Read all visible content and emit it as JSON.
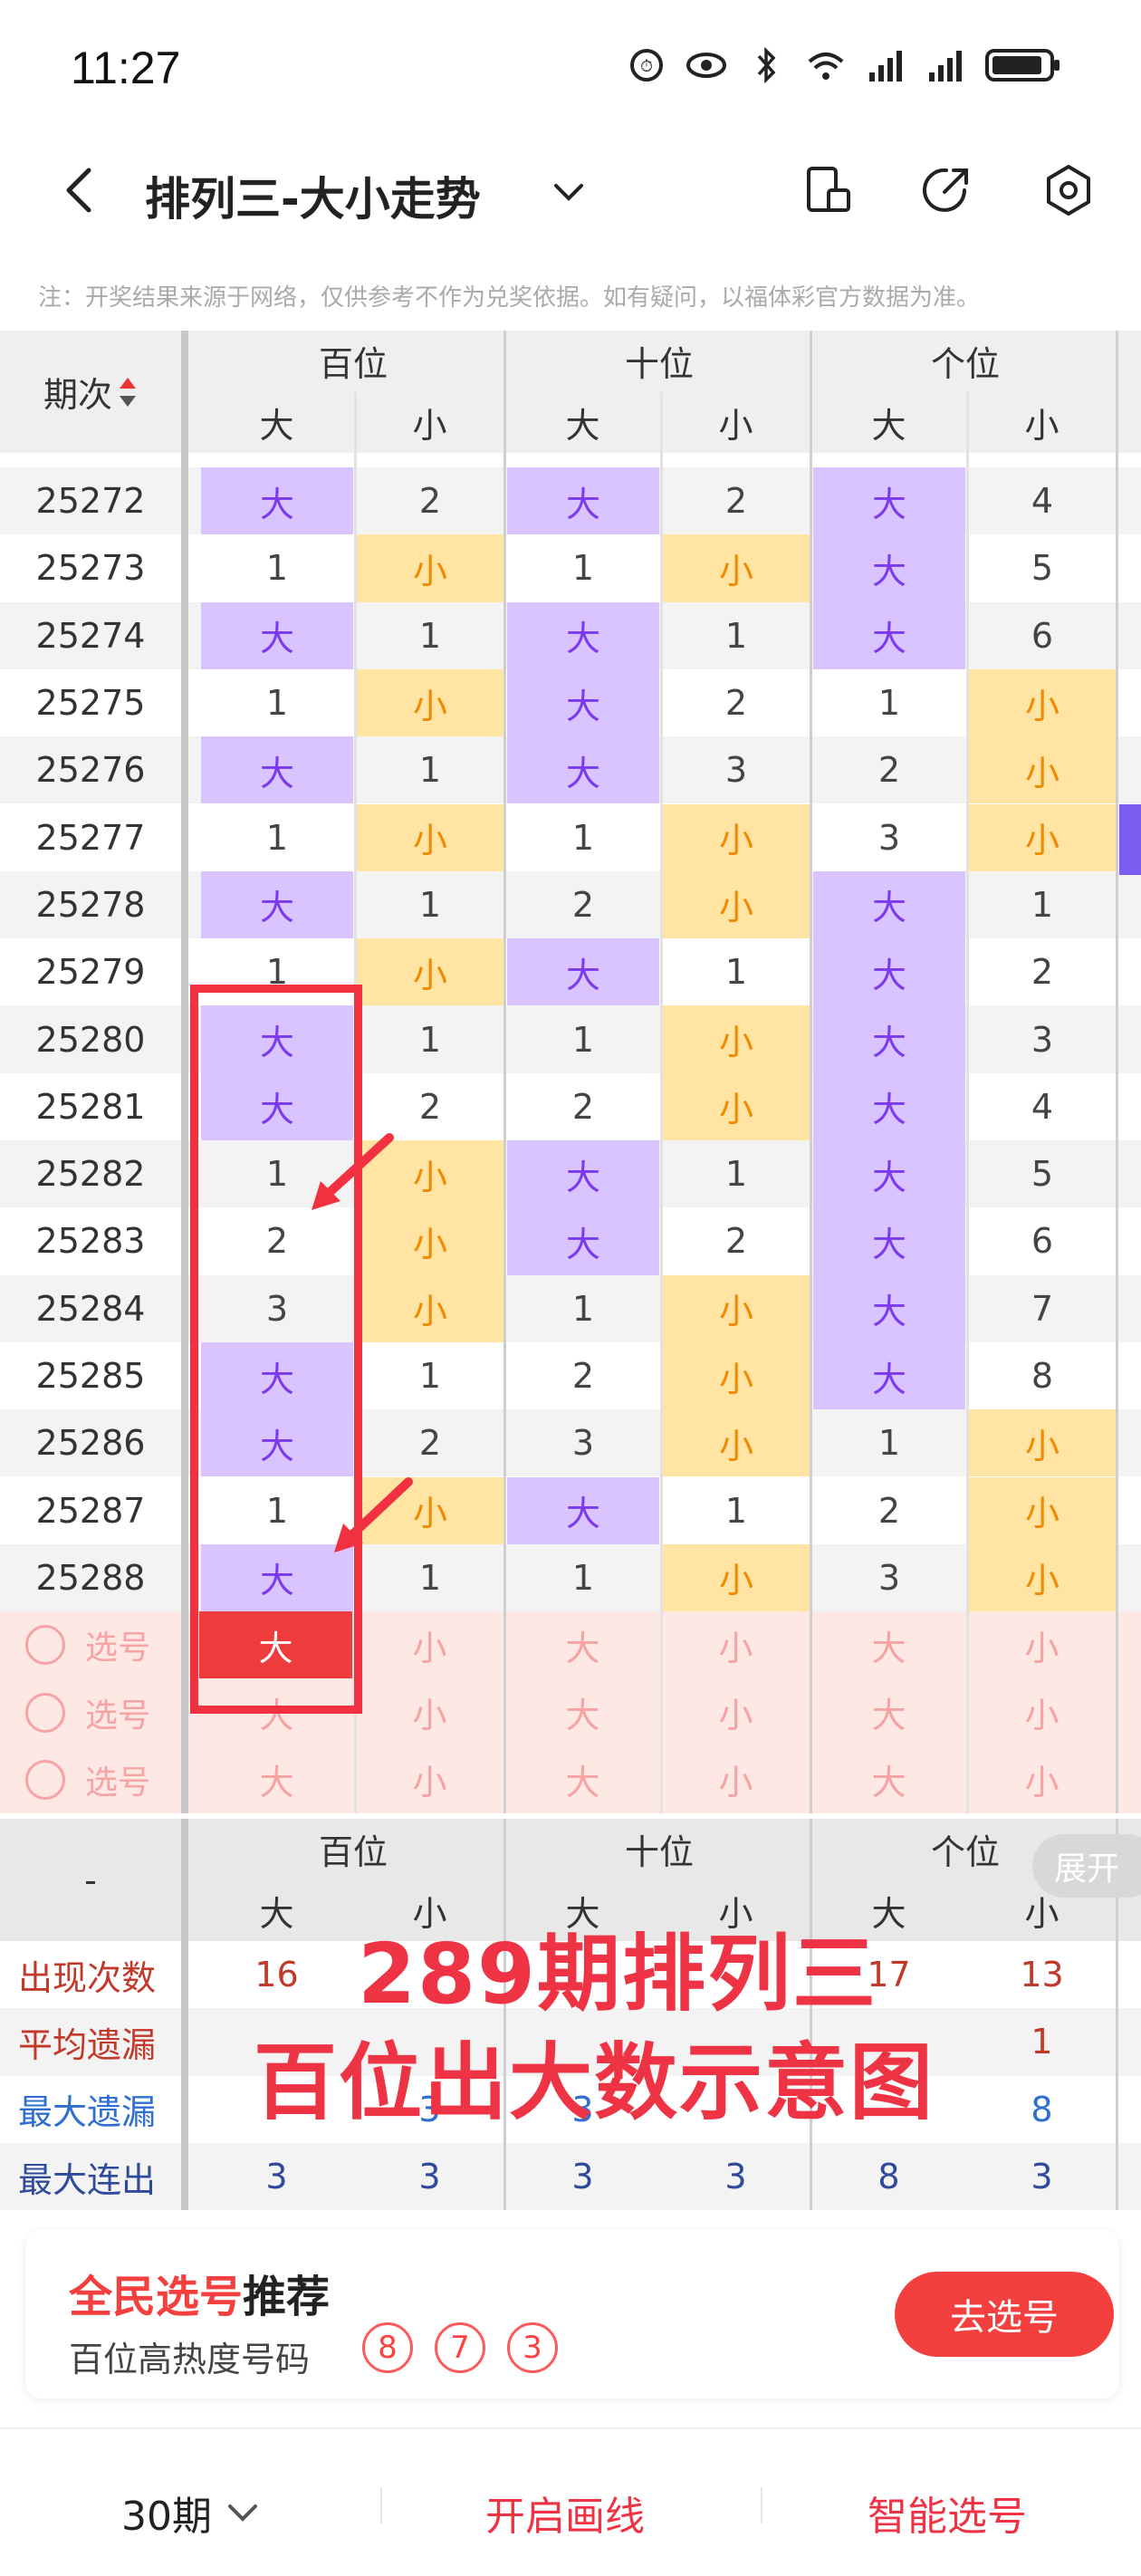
{
  "status": {
    "time": "11:27"
  },
  "header": {
    "title": "排列三-大小走势"
  },
  "notice": "注：开奖结果来源于网络，仅供参考不作为兑奖依据。如有疑问，以福体彩官方数据为准。",
  "table": {
    "period_header": "期次",
    "groups": [
      "百位",
      "十位",
      "个位"
    ],
    "sub_labels": [
      "大",
      "小"
    ],
    "rows": [
      {
        "period": "25272",
        "cells": [
          "大",
          "2",
          "大",
          "2",
          "大",
          "4"
        ]
      },
      {
        "period": "25273",
        "cells": [
          "1",
          "小",
          "1",
          "小",
          "大",
          "5"
        ]
      },
      {
        "period": "25274",
        "cells": [
          "大",
          "1",
          "大",
          "1",
          "大",
          "6"
        ]
      },
      {
        "period": "25275",
        "cells": [
          "1",
          "小",
          "大",
          "2",
          "1",
          "小"
        ]
      },
      {
        "period": "25276",
        "cells": [
          "大",
          "1",
          "大",
          "3",
          "2",
          "小"
        ]
      },
      {
        "period": "25277",
        "cells": [
          "1",
          "小",
          "1",
          "小",
          "3",
          "小"
        ]
      },
      {
        "period": "25278",
        "cells": [
          "大",
          "1",
          "2",
          "小",
          "大",
          "1"
        ]
      },
      {
        "period": "25279",
        "cells": [
          "1",
          "小",
          "大",
          "1",
          "大",
          "2"
        ]
      },
      {
        "period": "25280",
        "cells": [
          "大",
          "1",
          "1",
          "小",
          "大",
          "3"
        ]
      },
      {
        "period": "25281",
        "cells": [
          "大",
          "2",
          "2",
          "小",
          "大",
          "4"
        ]
      },
      {
        "period": "25282",
        "cells": [
          "1",
          "小",
          "大",
          "1",
          "大",
          "5"
        ]
      },
      {
        "period": "25283",
        "cells": [
          "2",
          "小",
          "大",
          "2",
          "大",
          "6"
        ]
      },
      {
        "period": "25284",
        "cells": [
          "3",
          "小",
          "1",
          "小",
          "大",
          "7"
        ]
      },
      {
        "period": "25285",
        "cells": [
          "大",
          "1",
          "2",
          "小",
          "大",
          "8"
        ]
      },
      {
        "period": "25286",
        "cells": [
          "大",
          "2",
          "3",
          "小",
          "1",
          "小"
        ]
      },
      {
        "period": "25287",
        "cells": [
          "1",
          "小",
          "大",
          "1",
          "2",
          "小"
        ]
      },
      {
        "period": "25288",
        "cells": [
          "大",
          "1",
          "1",
          "小",
          "3",
          "小"
        ]
      }
    ],
    "pick_label": "选号",
    "pick_rows": [
      [
        "大",
        "小",
        "大",
        "小",
        "大",
        "小"
      ],
      [
        "大",
        "小",
        "大",
        "小",
        "大",
        "小"
      ],
      [
        "大",
        "小",
        "大",
        "小",
        "大",
        "小"
      ]
    ],
    "pick_selected_text": "大"
  },
  "summary": {
    "dash": "-",
    "expand": "展开",
    "rows": [
      {
        "label": "出现次数",
        "color": "#c0392b",
        "values": [
          "16",
          "",
          "",
          "",
          "17",
          "13"
        ]
      },
      {
        "label": "平均遗漏",
        "color": "#c0392b",
        "values": [
          "",
          "",
          "",
          "",
          "",
          "1"
        ]
      },
      {
        "label": "最大遗漏",
        "color": "#2f6fd1",
        "values": [
          "",
          "3",
          "3",
          "",
          "",
          "8"
        ]
      },
      {
        "label": "最大连出",
        "color": "#2f4a9a",
        "values": [
          "3",
          "3",
          "3",
          "3",
          "8",
          "3"
        ]
      }
    ]
  },
  "overlay": {
    "line1": "289期排列三",
    "line2": "百位出大数示意图"
  },
  "card": {
    "title_red": "全民选号",
    "title_black": "推荐",
    "subtitle": "百位高热度号码",
    "hot_numbers": [
      "8",
      "7",
      "3"
    ],
    "button": "去选号"
  },
  "bottom": {
    "periods": "30期",
    "draw_line": "开启画线",
    "smart_pick": "智能选号"
  },
  "colors": {
    "big": "#7c3aed",
    "small": "#f08a00",
    "big_bg": "#d9c4ff",
    "small_bg": "#ffe4a4",
    "accent_red": "#f43f3f"
  }
}
